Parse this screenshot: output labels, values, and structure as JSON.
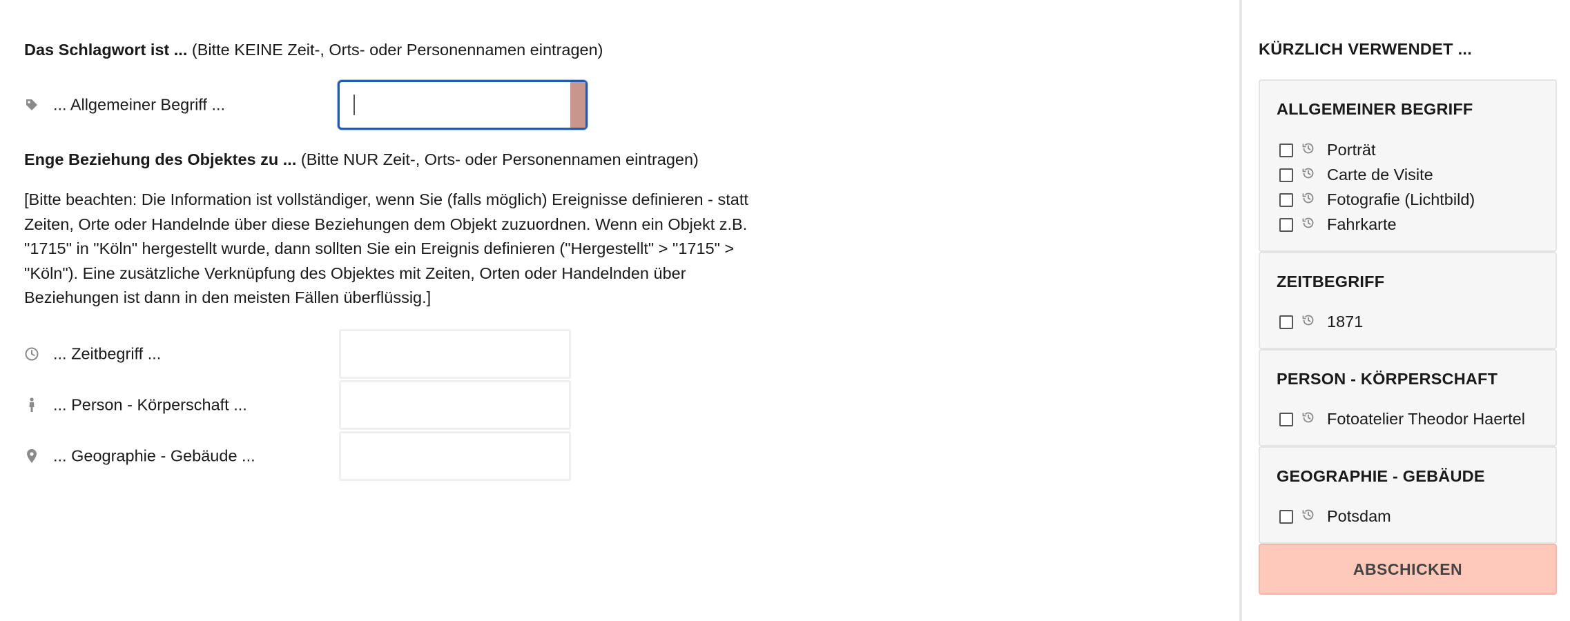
{
  "keyword_section": {
    "heading_bold": "Das Schlagwort ist ...",
    "heading_hint": "(Bitte KEINE Zeit-, Orts- oder Personennamen eintragen)",
    "general_term": {
      "label": "... Allgemeiner Begriff ...",
      "icon": "tag-icon",
      "value": ""
    }
  },
  "relation_section": {
    "heading_bold": "Enge Beziehung des Objektes zu ...",
    "heading_hint": "(Bitte NUR Zeit-, Orts- oder Personennamen eintragen)",
    "note": "[Bitte beachten: Die Information ist vollständiger, wenn Sie (falls möglich) Ereignisse definieren - statt Zeiten, Orte oder Handelnde über diese Beziehungen dem Objekt zuzuordnen. Wenn ein Objekt z.B. \"1715\" in \"Köln\" hergestellt wurde, dann sollten Sie ein Ereignis definieren (\"Hergestellt\" > \"1715\" > \"Köln\"). Eine zusätzliche Verknüpfung des Objektes mit Zeiten, Orten oder Handelnden über Beziehungen ist dann in den meisten Fällen überflüssig.]",
    "fields": [
      {
        "label": "... Zeitbegriff ...",
        "icon": "clock-icon",
        "value": ""
      },
      {
        "label": "... Person - Körperschaft ...",
        "icon": "person-icon",
        "value": ""
      },
      {
        "label": "... Geographie - Gebäude ...",
        "icon": "map-pin-icon",
        "value": ""
      }
    ]
  },
  "sidebar": {
    "title": "KÜRZLICH VERWENDET ...",
    "groups": [
      {
        "title": "ALLGEMEINER BEGRIFF",
        "items": [
          "Porträt",
          "Carte de Visite",
          "Fotografie (Lichtbild)",
          "Fahrkarte"
        ]
      },
      {
        "title": "ZEITBEGRIFF",
        "items": [
          "1871"
        ]
      },
      {
        "title": "PERSON - KÖRPERSCHAFT",
        "items": [
          "Fotoatelier Theodor Haertel"
        ]
      },
      {
        "title": "GEOGRAPHIE - GEBÄUDE",
        "items": [
          "Potsdam"
        ]
      }
    ],
    "submit_label": "ABSCHICKEN"
  },
  "colors": {
    "focus_border": "#1e5bb5",
    "submit_bg": "#fec8ba",
    "input_side_accent": "#c8968a"
  }
}
